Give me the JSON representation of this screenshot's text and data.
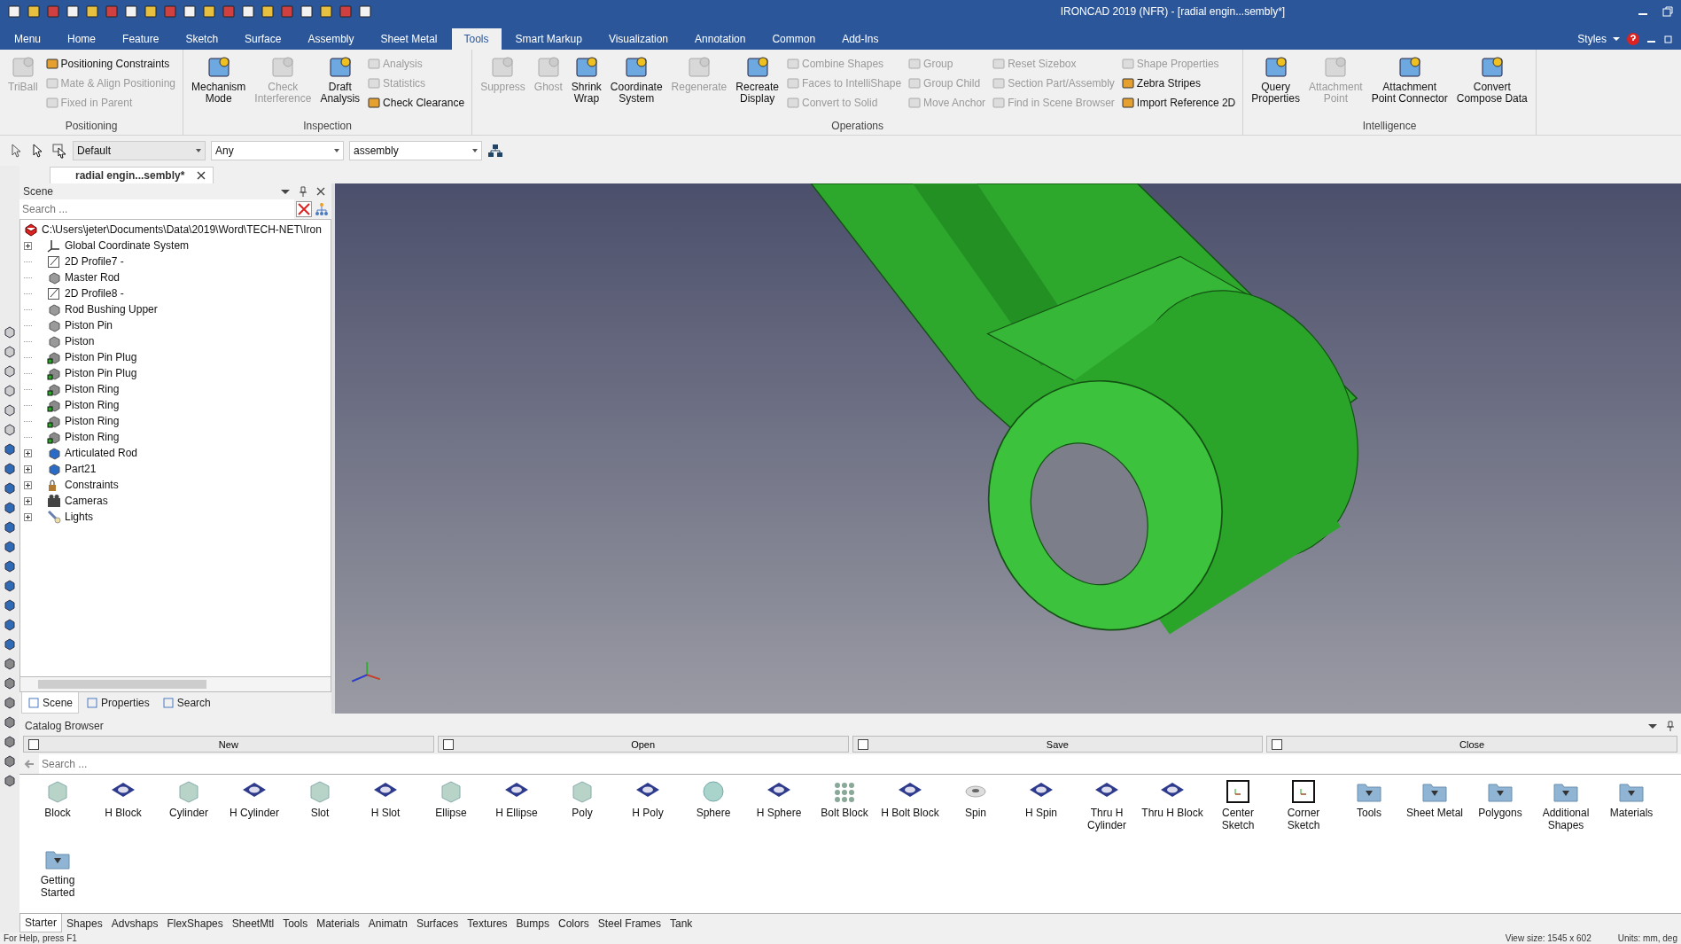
{
  "window": {
    "title": "IRONCAD 2019 (NFR) - [radial engin...sembly*]"
  },
  "menu_tabs": [
    {
      "label": "Menu",
      "selected": false
    },
    {
      "label": "Home",
      "selected": false
    },
    {
      "label": "Feature",
      "selected": false
    },
    {
      "label": "Sketch",
      "selected": false
    },
    {
      "label": "Surface",
      "selected": false
    },
    {
      "label": "Assembly",
      "selected": false
    },
    {
      "label": "Sheet Metal",
      "selected": false
    },
    {
      "label": "Tools",
      "selected": true
    },
    {
      "label": "Smart Markup",
      "selected": false
    },
    {
      "label": "Visualization",
      "selected": false
    },
    {
      "label": "Annotation",
      "selected": false
    },
    {
      "label": "Common",
      "selected": false
    },
    {
      "label": "Add-Ins",
      "selected": false
    }
  ],
  "styles_label": "Styles",
  "ribbon": {
    "groups": [
      {
        "label": "Positioning",
        "columns": [
          {
            "kind": "large",
            "items": [
              {
                "label": "TriBall",
                "disabled": true
              }
            ]
          },
          {
            "kind": "stack",
            "items": [
              {
                "label": "Positioning Constraints",
                "disabled": false
              },
              {
                "label": "Mate & Align Positioning",
                "disabled": true
              },
              {
                "label": "Fixed in Parent",
                "disabled": true
              }
            ]
          }
        ]
      },
      {
        "label": "Inspection",
        "columns": [
          {
            "kind": "large",
            "items": [
              {
                "label": "Mechanism\nMode",
                "disabled": false
              }
            ]
          },
          {
            "kind": "large",
            "items": [
              {
                "label": "Check\nInterference",
                "disabled": true
              }
            ]
          },
          {
            "kind": "large",
            "items": [
              {
                "label": "Draft\nAnalysis",
                "disabled": false
              }
            ]
          },
          {
            "kind": "stack",
            "items": [
              {
                "label": "Analysis",
                "disabled": true
              },
              {
                "label": "Statistics",
                "disabled": true
              },
              {
                "label": "Check Clearance",
                "disabled": false
              }
            ]
          }
        ]
      },
      {
        "label": "Operations",
        "columns": [
          {
            "kind": "large",
            "items": [
              {
                "label": "Suppress",
                "disabled": true
              }
            ]
          },
          {
            "kind": "large",
            "items": [
              {
                "label": "Ghost",
                "disabled": true
              }
            ]
          },
          {
            "kind": "large",
            "items": [
              {
                "label": "Shrink\nWrap",
                "disabled": false
              }
            ]
          },
          {
            "kind": "large",
            "items": [
              {
                "label": "Coordinate\nSystem",
                "disabled": false
              }
            ]
          },
          {
            "kind": "large",
            "items": [
              {
                "label": "Regenerate",
                "disabled": true
              }
            ]
          },
          {
            "kind": "large",
            "items": [
              {
                "label": "Recreate\nDisplay",
                "disabled": false
              }
            ]
          },
          {
            "kind": "stack",
            "items": [
              {
                "label": "Combine Shapes",
                "disabled": true
              },
              {
                "label": "Faces to IntelliShape",
                "disabled": true
              },
              {
                "label": "Convert to Solid",
                "disabled": true
              }
            ]
          },
          {
            "kind": "stack",
            "items": [
              {
                "label": "Group",
                "disabled": true
              },
              {
                "label": "Group Child",
                "disabled": true
              },
              {
                "label": "Move Anchor",
                "disabled": true
              }
            ]
          },
          {
            "kind": "stack",
            "items": [
              {
                "label": "Reset Sizebox",
                "disabled": true
              },
              {
                "label": "Section Part/Assembly",
                "disabled": true
              },
              {
                "label": "Find in Scene Browser",
                "disabled": true
              }
            ]
          },
          {
            "kind": "stack",
            "items": [
              {
                "label": "Shape Properties",
                "disabled": true
              },
              {
                "label": "Zebra Stripes",
                "disabled": false
              },
              {
                "label": "Import Reference 2D",
                "disabled": false
              }
            ]
          }
        ]
      },
      {
        "label": "Intelligence",
        "columns": [
          {
            "kind": "large",
            "items": [
              {
                "label": "Query\nProperties",
                "disabled": false
              }
            ]
          },
          {
            "kind": "large",
            "items": [
              {
                "label": "Attachment\nPoint",
                "disabled": true
              }
            ]
          },
          {
            "kind": "large",
            "items": [
              {
                "label": "Attachment\nPoint Connector",
                "disabled": false
              }
            ]
          },
          {
            "kind": "large",
            "items": [
              {
                "label": "Convert\nCompose Data",
                "disabled": false
              }
            ]
          }
        ]
      }
    ]
  },
  "toolbar": {
    "style": "Default",
    "filter": "Any",
    "mode": "assembly"
  },
  "document_tab": {
    "label": "radial engin...sembly*"
  },
  "scene_panel": {
    "title": "Scene",
    "search": {
      "placeholder": "Search ..."
    },
    "tree": {
      "label": "C:\\Users\\jeter\\Documents\\Data\\2019\\Word\\TECH-NET\\Iron",
      "kind": "scene",
      "children": [
        {
          "label": "Global Coordinate System",
          "kind": "coord",
          "expander": true
        },
        {
          "label": "2D Profile7 -",
          "kind": "sketch",
          "expander": false
        },
        {
          "label": "Master Rod",
          "kind": "part",
          "expander": false
        },
        {
          "label": "2D Profile8 -",
          "kind": "sketch",
          "expander": false
        },
        {
          "label": "Rod Bushing Upper",
          "kind": "part",
          "expander": false
        },
        {
          "label": "Piston Pin",
          "kind": "part",
          "expander": false
        },
        {
          "label": "Piston",
          "kind": "part",
          "expander": false
        },
        {
          "label": "Piston Pin Plug",
          "kind": "linked",
          "expander": false
        },
        {
          "label": "Piston Pin Plug",
          "kind": "linked",
          "expander": false
        },
        {
          "label": "Piston Ring",
          "kind": "linked",
          "expander": false
        },
        {
          "label": "Piston Ring",
          "kind": "linked",
          "expander": false
        },
        {
          "label": "Piston Ring",
          "kind": "linked",
          "expander": false
        },
        {
          "label": "Piston Ring",
          "kind": "linked",
          "expander": false
        },
        {
          "label": "Articulated Rod",
          "kind": "assembly",
          "expander": true
        },
        {
          "label": "Part21",
          "kind": "assembly",
          "expander": true
        },
        {
          "label": "Constraints",
          "kind": "constraints",
          "expander": true
        },
        {
          "label": "Cameras",
          "kind": "cameras",
          "expander": true
        },
        {
          "label": "Lights",
          "kind": "lights",
          "expander": true
        }
      ]
    },
    "tabs": [
      {
        "label": "Scene",
        "selected": true
      },
      {
        "label": "Properties",
        "selected": false
      },
      {
        "label": "Search",
        "selected": false
      }
    ]
  },
  "catalog": {
    "title": "Catalog Browser",
    "buttons": [
      "New",
      "Open",
      "Save",
      "Close"
    ],
    "search": {
      "placeholder": "Search ..."
    },
    "items": [
      {
        "label": "Block",
        "kind": "solid"
      },
      {
        "label": "H Block",
        "kind": "hole"
      },
      {
        "label": "Cylinder",
        "kind": "solid"
      },
      {
        "label": "H Cylinder",
        "kind": "hole"
      },
      {
        "label": "Slot",
        "kind": "solid"
      },
      {
        "label": "H Slot",
        "kind": "hole"
      },
      {
        "label": "Ellipse",
        "kind": "solid"
      },
      {
        "label": "H Ellipse",
        "kind": "hole"
      },
      {
        "label": "Poly",
        "kind": "solid"
      },
      {
        "label": "H Poly",
        "kind": "hole"
      },
      {
        "label": "Sphere",
        "kind": "sphere"
      },
      {
        "label": "H Sphere",
        "kind": "hole"
      },
      {
        "label": "Bolt Block",
        "kind": "pattern"
      },
      {
        "label": "H Bolt Block",
        "kind": "hole"
      },
      {
        "label": "Spin",
        "kind": "spin"
      },
      {
        "label": "H Spin",
        "kind": "hole"
      },
      {
        "label": "Thru H Cylinder",
        "kind": "hole"
      },
      {
        "label": "Thru H Block",
        "kind": "hole"
      },
      {
        "label": "Center Sketch",
        "kind": "sketch"
      },
      {
        "label": "Corner Sketch",
        "kind": "sketch"
      },
      {
        "label": "Tools",
        "kind": "folder"
      },
      {
        "label": "Sheet Metal",
        "kind": "folder"
      },
      {
        "label": "Polygons",
        "kind": "folder"
      },
      {
        "label": "Additional Shapes",
        "kind": "folder"
      },
      {
        "label": "Materials",
        "kind": "folder"
      },
      {
        "label": "Getting Started",
        "kind": "folder"
      }
    ],
    "tabs": [
      {
        "label": "Starter",
        "selected": true
      },
      {
        "label": "Shapes",
        "selected": false
      },
      {
        "label": "Advshaps",
        "selected": false
      },
      {
        "label": "FlexShapes",
        "selected": false
      },
      {
        "label": "SheetMtl",
        "selected": false
      },
      {
        "label": "Tools",
        "selected": false
      },
      {
        "label": "Materials",
        "selected": false
      },
      {
        "label": "Animatn",
        "selected": false
      },
      {
        "label": "Surfaces",
        "selected": false
      },
      {
        "label": "Textures",
        "selected": false
      },
      {
        "label": "Bumps",
        "selected": false
      },
      {
        "label": "Colors",
        "selected": false
      },
      {
        "label": "Steel Frames",
        "selected": false
      },
      {
        "label": "Tank",
        "selected": false
      }
    ]
  },
  "status_bar": {
    "help": "For Help, press F1",
    "view_size": "View size: 1545 x 602",
    "units": "Units: mm, deg"
  }
}
